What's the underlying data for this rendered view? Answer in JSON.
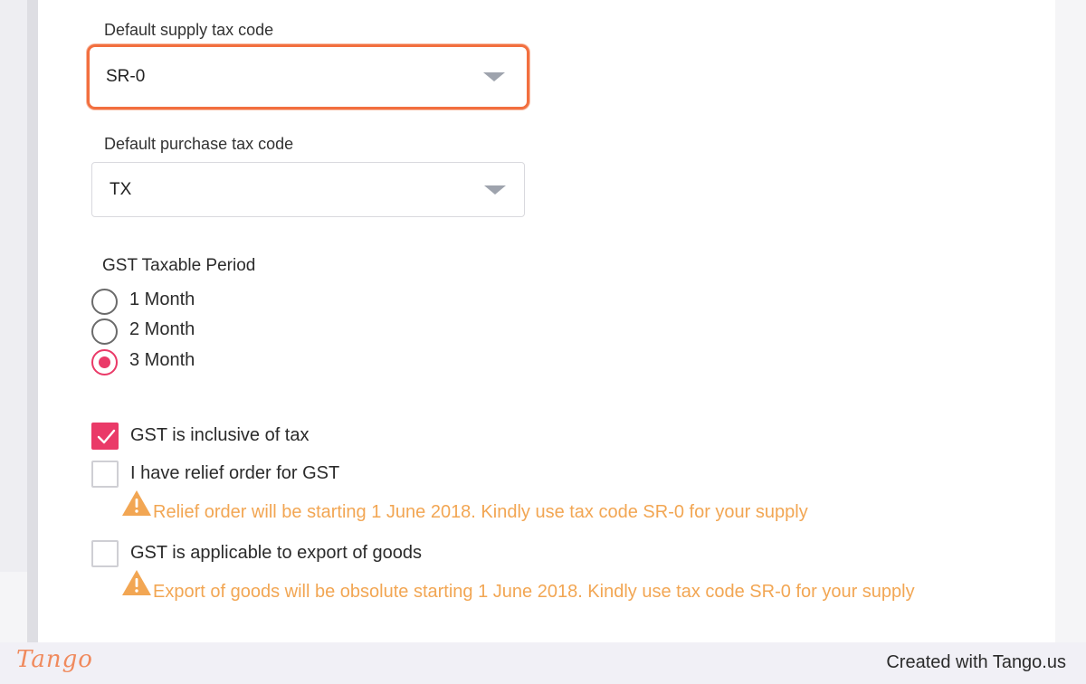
{
  "supply_tax": {
    "label": "Default supply tax code",
    "value": "SR-0"
  },
  "purchase_tax": {
    "label": "Default purchase tax code",
    "value": "TX"
  },
  "gst_period": {
    "title": "GST Taxable Period",
    "options": [
      {
        "label": "1 Month",
        "checked": false
      },
      {
        "label": "2 Month",
        "checked": false
      },
      {
        "label": "3 Month",
        "checked": true
      }
    ]
  },
  "checkboxes": [
    {
      "label": "GST is inclusive of tax",
      "checked": true
    },
    {
      "label": "I have relief order for GST",
      "checked": false,
      "warning": "Relief order will be starting 1 June 2018. Kindly use tax code SR-0 for your supply"
    },
    {
      "label": "GST is applicable to export of goods",
      "checked": false,
      "warning": "Export of goods will be obsolute starting 1 June 2018. Kindly use tax code SR-0 for your supply"
    }
  ],
  "footer": {
    "logo": "Tango",
    "credit": "Created with Tango.us"
  },
  "colors": {
    "accent": "#ea3a68",
    "focus_ring": "#f26f3f",
    "warning": "#f2a653"
  },
  "icons": [
    "chevron-down-icon",
    "warning-icon",
    "checkmark-icon"
  ]
}
